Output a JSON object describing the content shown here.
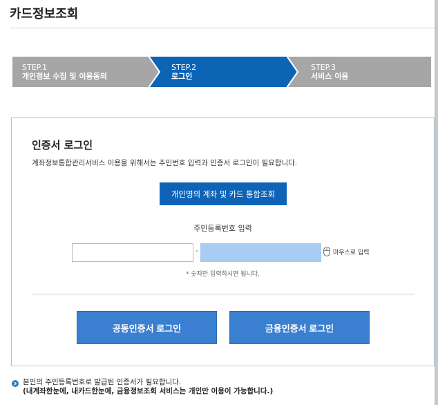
{
  "page": {
    "title": "카드정보조회"
  },
  "steps": [
    {
      "num": "STEP.1",
      "label": "개인정보 수집 및 이용동의",
      "color": "#a6a6a6"
    },
    {
      "num": "STEP.2",
      "label": "로그인",
      "color": "#0c64b5"
    },
    {
      "num": "STEP.3",
      "label": "서비스 이용",
      "color": "#a6a6a6"
    }
  ],
  "login": {
    "title": "인증서 로그인",
    "description": "계좌정보통합관리서비스 이용을 위해서는 주민번호 입력과 인증서 로그인이 필요합니다.",
    "integrated_button": "개인명의 계좌 및 카드 통합조회",
    "rrn_label": "주민등록번호 입력",
    "rrn_front_value": "",
    "rrn_back_value": "",
    "dash": "-",
    "mouse_input_label": "마우스로 입력",
    "hint": "* 숫자만 입력하시면 됩니다.",
    "public_cert_button": "공동인증서 로그인",
    "finance_cert_button": "금융인증서 로그인"
  },
  "notice": {
    "line1": "본인의 주민등록번호로 발급된 인증서가 필요합니다.",
    "line2": "(내계좌한눈에, 내카드한눈에, 금융정보조회 서비스는 개인만 이용이 가능합니다.)"
  },
  "colors": {
    "primary": "#0e63b6",
    "cert_button": "#3a7fd0",
    "rrn_highlight": "#a8cdf2",
    "step_inactive": "#a6a6a6"
  }
}
